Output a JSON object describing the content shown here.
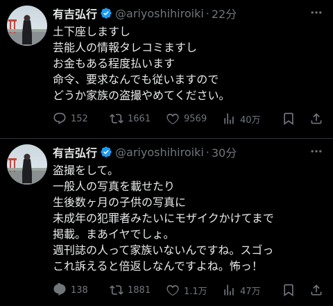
{
  "tweets": [
    {
      "author": {
        "name": "有吉弘行",
        "handle": "@ariyoshihiroiki",
        "verified": true
      },
      "separator": "·",
      "time": "22分",
      "lines": [
        "土下座しますし",
        "芸能人の情報タレコミますし",
        "お金もある程度払います",
        "命令、要求なんでも従いますので",
        "どうか家族の盗撮やめてください。"
      ],
      "stats": {
        "replies": "152",
        "retweets": "1661",
        "likes": "9569",
        "views": "40万"
      }
    },
    {
      "author": {
        "name": "有吉弘行",
        "handle": "@ariyoshihiroiki",
        "verified": true
      },
      "separator": "·",
      "time": "30分",
      "lines": [
        "盗撮をして。",
        "一般人の写真を載せたり",
        "生後数ヶ月の子供の写真に",
        "未成年の犯罪者みたいにモザイクかけてまで",
        "掲載。まあイヤでしょ。",
        "週刊誌の人って家族いないんですね。スゴっ",
        "これ訴えると倍返しなんですよね。怖っ！"
      ],
      "stats": {
        "replies": "138",
        "retweets": "1881",
        "likes": "1.1万",
        "views": "47万"
      }
    }
  ],
  "icons": {
    "verified": "verified-badge-icon",
    "more": "more-dots-icon",
    "reply": "reply-icon",
    "retweet": "retweet-icon",
    "like": "heart-icon",
    "views": "views-bar-chart-icon",
    "bookmark": "bookmark-icon",
    "share": "share-icon"
  },
  "colors": {
    "background": "#000000",
    "text": "#e7e9ea",
    "muted": "#71767b",
    "verified": "#1d9bf0",
    "divider": "#2f3336"
  }
}
